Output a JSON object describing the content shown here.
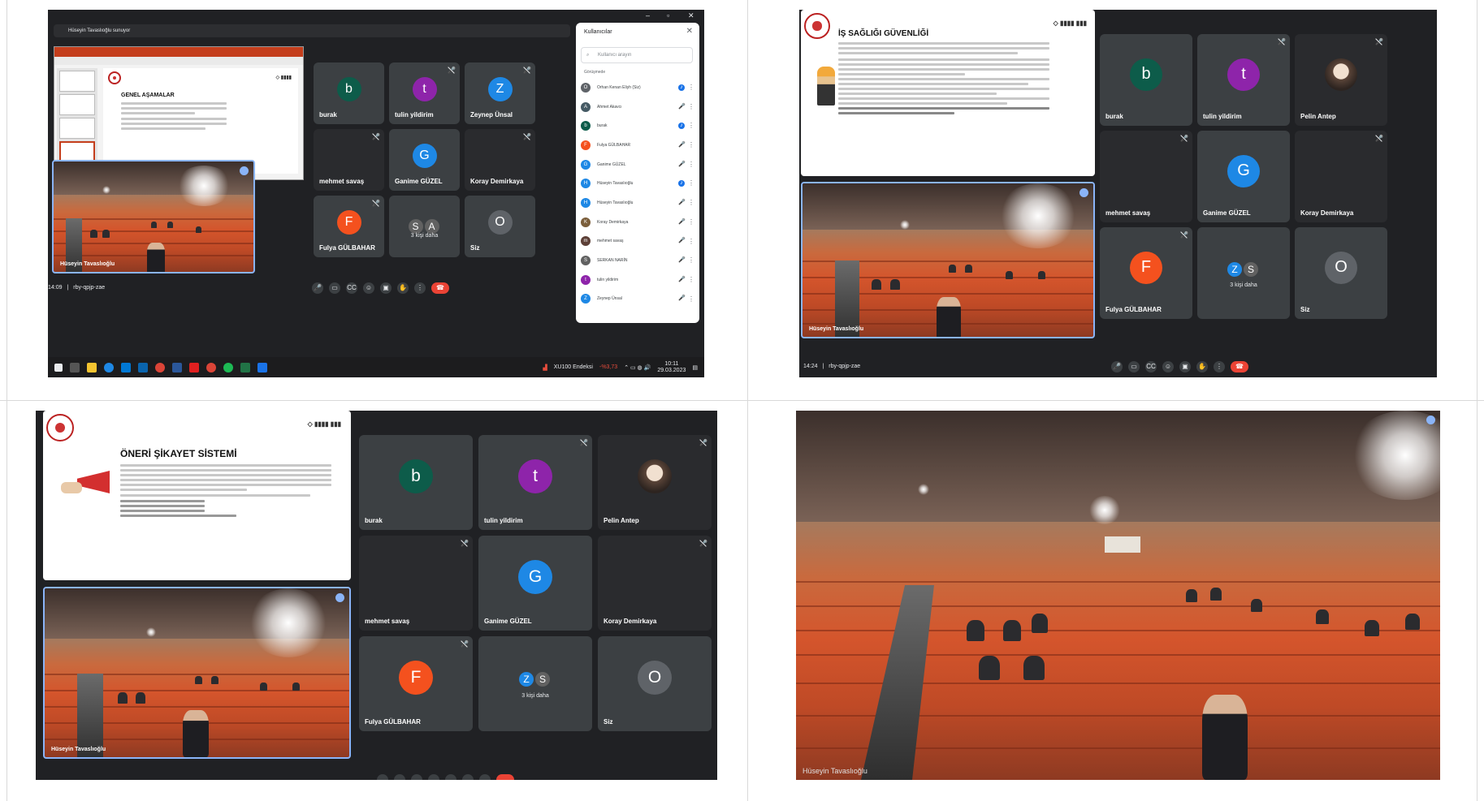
{
  "q1": {
    "presenter_bar": "Hüseyin Tavaslıoğlu sunuyor",
    "slide": {
      "title": "GENEL AŞAMALAR"
    },
    "tiles": [
      {
        "name": "burak",
        "initial": "b",
        "color": "#0d5c4a"
      },
      {
        "name": "tulin yildirim",
        "initial": "t",
        "color": "#8e24aa"
      },
      {
        "name": "Zeynep Ünsal",
        "initial": "Z",
        "color": "#1e88e5"
      },
      {
        "name": "mehmet savaş",
        "initial": "",
        "color": ""
      },
      {
        "name": "Ganime GÜZEL",
        "initial": "G",
        "color": "#1e88e5"
      },
      {
        "name": "Koray Demirkaya",
        "initial": "",
        "color": ""
      },
      {
        "name": "Fulya GÜLBAHAR",
        "initial": "F",
        "color": "#f4511e"
      },
      {
        "name": "",
        "initial": "",
        "color": ""
      },
      {
        "name": "Siz",
        "initial": "O",
        "color": "#5f6368"
      }
    ],
    "more": {
      "a": "S",
      "b": "A",
      "label": "3 kişi daha"
    },
    "hall_label": "Hüseyin Tavaslıoğlu",
    "time": "14:09",
    "code": "rby-qpjp-zae",
    "people_panel": {
      "title": "Kullanıcılar",
      "search_placeholder": "Kullanıcı arayın",
      "group": "Görüşmede",
      "people": [
        {
          "name": "Orhan Kenan Eliyh (Siz)",
          "initial": "O",
          "color": "#5f6368"
        },
        {
          "name": "Ahmet Akavcı",
          "initial": "A",
          "color": "#455a64"
        },
        {
          "name": "burak",
          "initial": "b",
          "color": "#0d5c4a"
        },
        {
          "name": "Fulya GÜLBAHAR",
          "initial": "F",
          "color": "#f4511e"
        },
        {
          "name": "Ganime GÜZEL",
          "initial": "G",
          "color": "#1e88e5"
        },
        {
          "name": "Hüseyin Tavaslıoğlu",
          "initial": "H",
          "color": "#1e88e5"
        },
        {
          "name": "Hüseyin Tavaslıoğlu",
          "initial": "H",
          "color": "#1e88e5"
        },
        {
          "name": "Koray Demirkaya",
          "initial": "K",
          "color": "#7b5e3b"
        },
        {
          "name": "mehmet savaş",
          "initial": "m",
          "color": "#5d4037"
        },
        {
          "name": "SERKAN NARİN",
          "initial": "S",
          "color": "#616161"
        },
        {
          "name": "tulin yildirim",
          "initial": "t",
          "color": "#8e24aa"
        },
        {
          "name": "Zeynep Ünsal",
          "initial": "Z",
          "color": "#1e88e5"
        }
      ]
    },
    "taskbar": {
      "ticker": "XU100 Endeksi",
      "change": "-%3,73",
      "clock": "10:11",
      "date": "29.03.2023"
    }
  },
  "q2": {
    "slide": {
      "title": "İŞ SAĞLIĞI GÜVENLİĞİ"
    },
    "tiles": [
      {
        "name": "burak",
        "initial": "b",
        "color": "#0d5c4a"
      },
      {
        "name": "tulin yildirim",
        "initial": "t",
        "color": "#8e24aa"
      },
      {
        "name": "Pelin Antep",
        "initial": "",
        "color": ""
      },
      {
        "name": "mehmet savaş",
        "initial": "",
        "color": ""
      },
      {
        "name": "Ganime GÜZEL",
        "initial": "G",
        "color": "#1e88e5"
      },
      {
        "name": "Koray Demirkaya",
        "initial": "",
        "color": ""
      },
      {
        "name": "Fulya GÜLBAHAR",
        "initial": "F",
        "color": "#f4511e"
      },
      {
        "name": "",
        "initial": "",
        "color": ""
      },
      {
        "name": "Siz",
        "initial": "O",
        "color": "#5f6368"
      }
    ],
    "more": {
      "a": "Z",
      "b": "S",
      "label": "3 kişi daha"
    },
    "hall_label": "Hüseyin Tavaslıoğlu",
    "time": "14:24",
    "code": "rby-qpjp-zae"
  },
  "q3": {
    "slide": {
      "title": "ÖNERİ ŞİKAYET SİSTEMİ"
    },
    "tiles": [
      {
        "name": "burak",
        "initial": "b",
        "color": "#0d5c4a"
      },
      {
        "name": "tulin yildirim",
        "initial": "t",
        "color": "#8e24aa"
      },
      {
        "name": "Pelin Antep",
        "initial": "",
        "color": ""
      },
      {
        "name": "mehmet savaş",
        "initial": "",
        "color": ""
      },
      {
        "name": "Ganime GÜZEL",
        "initial": "G",
        "color": "#1e88e5"
      },
      {
        "name": "Koray Demirkaya",
        "initial": "",
        "color": ""
      },
      {
        "name": "Fulya GÜLBAHAR",
        "initial": "F",
        "color": "#f4511e"
      },
      {
        "name": "",
        "initial": "",
        "color": ""
      },
      {
        "name": "Siz",
        "initial": "O",
        "color": "#5f6368"
      }
    ],
    "more": {
      "a": "Z",
      "b": "S",
      "label": "3 kişi daha"
    },
    "hall_label": "Hüseyin Tavaslıoğlu"
  },
  "q4": {
    "hall_label": "Hüseyin Tavaslıoğlu"
  }
}
